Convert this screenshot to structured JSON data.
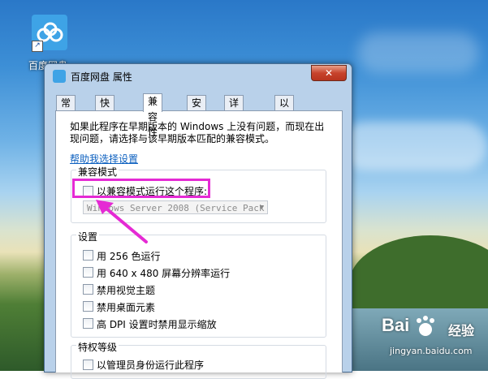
{
  "desktop": {
    "icon_label": "百度网盘"
  },
  "window": {
    "title": "百度网盘 属性",
    "close_glyph": "✕",
    "tabs": [
      {
        "label": "常规"
      },
      {
        "label": "快捷方式"
      },
      {
        "label": "兼容性"
      },
      {
        "label": "安全"
      },
      {
        "label": "详细信息"
      },
      {
        "label": "以前的版本"
      }
    ],
    "intro_line1": "如果此程序在早期版本的 Windows 上没有问题，而现在出",
    "intro_line2": "现问题，请选择与该早期版本匹配的兼容模式。",
    "help_link": "帮助我选择设置",
    "compat": {
      "heading": "兼容模式",
      "checkbox_label": "以兼容模式运行这个程序:",
      "select_value": "Windows Server 2008 (Service Pack"
    },
    "settings": {
      "heading": "设置",
      "options": [
        {
          "label": "用 256 色运行"
        },
        {
          "label": "用 640 x 480 屏幕分辨率运行"
        },
        {
          "label": "禁用视觉主题"
        },
        {
          "label": "禁用桌面元素"
        },
        {
          "label": "高 DPI 设置时禁用显示缩放"
        }
      ]
    },
    "privilege": {
      "heading": "特权等级",
      "checkbox_label": "以管理员身份运行此程序"
    }
  },
  "watermark": {
    "brand": "Bai",
    "brand_suffix": "经验",
    "url": "jingyan.baidu.com"
  },
  "colors": {
    "highlight": "#e52ad4",
    "link": "#0b5fbf"
  }
}
